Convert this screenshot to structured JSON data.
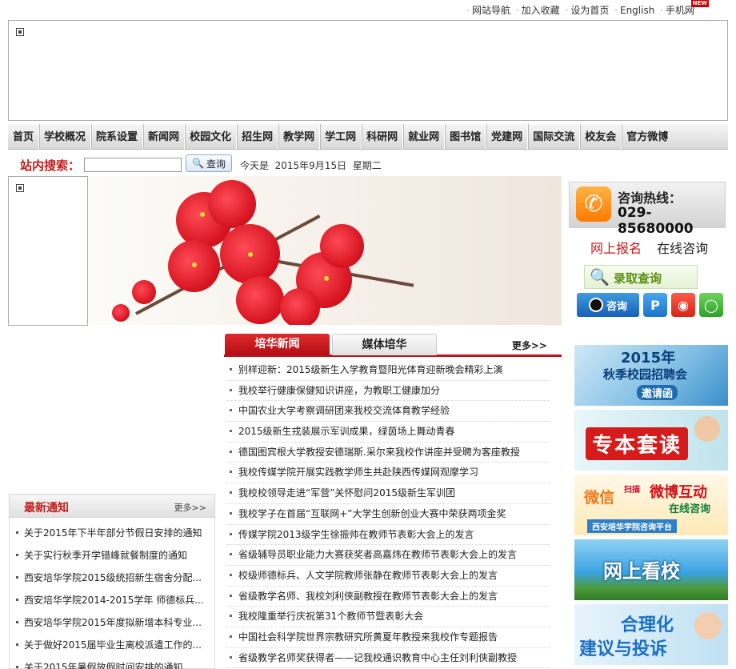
{
  "top_links": [
    "网站导航",
    "加入收藏",
    "设为首页",
    "English",
    "手机网"
  ],
  "top_badge": "NEW",
  "nav": [
    "首页",
    "学校概况",
    "院系设置",
    "新闻网",
    "校园文化",
    "招生网",
    "教学网",
    "学工网",
    "科研网",
    "就业网",
    "图书馆",
    "党建网",
    "国际交流",
    "校友会",
    "官方微博"
  ],
  "search": {
    "label": "站内搜索：",
    "button": "查询",
    "placeholder": ""
  },
  "date_text": "今天是  2015年9月15日  星期二",
  "contact": {
    "hotline_label": "咨询热线：",
    "hotline_number": "029-85680000",
    "signup": "网上报名",
    "online": "在线咨询",
    "admission_query": "录取查询",
    "qq_label": "咨询"
  },
  "tabs": {
    "active": "培华新闻",
    "inactive": "媒体培华",
    "more": "更多>>"
  },
  "news": [
    "别样迎新：2015级新生入学教育暨阳光体育迎新晚会精彩上演",
    "我校举行健康保健知识讲座，为教职工健康加分",
    "中国农业大学考察调研团来我校交流体育教学经验",
    "2015级新生戎装展示军训成果，绿茵场上舞动青春",
    "德国图宾根大学教授安德瑞斯.采尔来我校作讲座并受聘为客座教授",
    "我校传媒学院开展实践教学师生共赴陕西传媒网观摩学习",
    "我校校领导走进“军营”关怀慰问2015级新生军训团",
    "我校学子在首届“互联网+”大学生创新创业大赛中荣获两项金奖",
    "传媒学院2013级学生徐振帅在教师节表彰大会上的发言",
    "省级辅导员职业能力大赛获奖者高嘉炜在教师节表彰大会上的发言",
    "校级师德标兵、人文学院教师张静在教师节表彰大会上的发言",
    "省级教学名师、我校刘利侠副教授在教师节表彰大会上的发言",
    "我校隆重举行庆祝第31个教师节暨表彰大会",
    "中国社会科学院世界宗教研究所黄夏年教授来我校作专题报告",
    "省级教学名师奖获得者——记我校通识教育中心主任刘利侠副教授"
  ],
  "notice": {
    "title": "最新通知",
    "more": "更多>>",
    "items": [
      "关于2015年下半年部分节假日安排的通知",
      "关于实行秋季开学错峰就餐制度的通知",
      "西安培华学院2015级统招新生宿舍分配...",
      "西安培华学院2014-2015学年 师德标兵...",
      "西安培华学院2015年度拟新增本科专业...",
      "关于做好2015届毕业生离校派遣工作的...",
      "关于2015年暑假放假时间安排的通知"
    ]
  },
  "right_banners": [
    {
      "line1": "2015年",
      "line2": "秋季校园招聘会",
      "line3": "邀请函"
    },
    {
      "line1": "专本套读"
    },
    {
      "line1": "微信",
      "line2": "扫描",
      "line3": "微博互动",
      "line4": "在线咨询",
      "line5": "西安培华学院咨询平台"
    },
    {
      "line1": "网上看校"
    },
    {
      "line1": "合理化",
      "line2": "建议与投诉"
    }
  ],
  "colors": {
    "accent_red": "#c51a1a",
    "nav_bg": "#e2e2e2",
    "tab_red": "#b8151d"
  }
}
